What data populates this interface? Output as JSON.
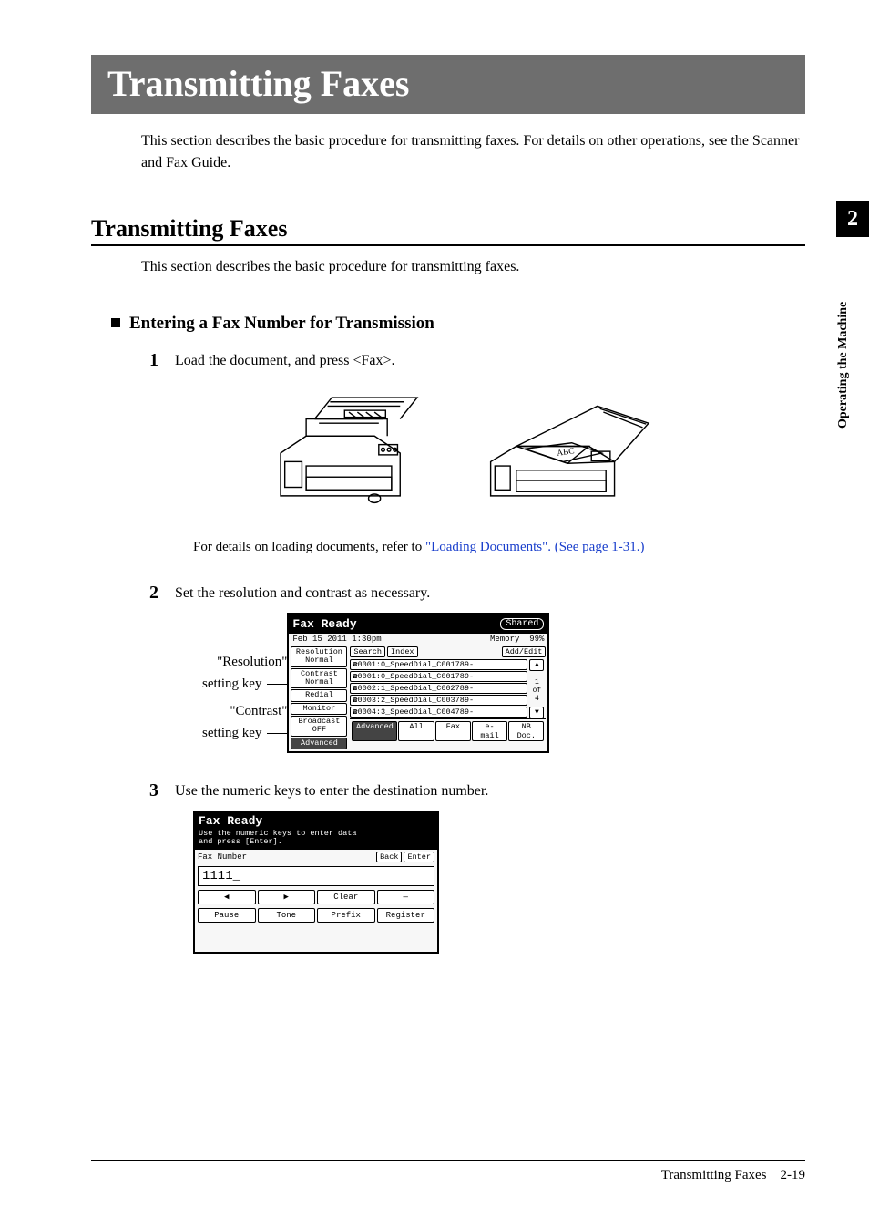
{
  "chapterTitle": "Transmitting Faxes",
  "intro": "This section describes the basic procedure for transmitting faxes. For details on other operations, see the Scanner and Fax Guide.",
  "sectionTitle": "Transmitting Faxes",
  "sectionIntro": "This section describes the basic procedure for transmitting faxes.",
  "subSectionTitle": "Entering a Fax Number for Transmission",
  "steps": {
    "s1num": "1",
    "s1text": "Load the document, and press <Fax>.",
    "s2num": "2",
    "s2text": "Set the resolution and contrast as necessary.",
    "s3num": "3",
    "s3text": "Use the numeric keys to enter the destination number."
  },
  "refPlain": "For details on loading documents, refer to ",
  "refLink": "\"Loading Documents\". (See page 1-31.)",
  "callout1a": "\"Resolution\"",
  "callout1b": "setting key",
  "callout2a": "\"Contrast\"",
  "callout2b": "setting key",
  "lcd": {
    "title": "Fax Ready",
    "shared": "Shared",
    "date": "Feb 15 2011  1:30pm",
    "memLabel": "Memory",
    "memVal": "99%",
    "resolution": "Resolution",
    "normal": "Normal",
    "contrast": "Contrast",
    "redial": "Redial",
    "monitor": "Monitor",
    "broadcast": "Broadcast",
    "off": "OFF",
    "advanced": "Advanced",
    "search": "Search",
    "index": "Index",
    "addEdit": "Add/Edit",
    "items": [
      "☎0001:0_SpeedDial_C001789-",
      "☎0001:0_SpeedDial_C001789-",
      "☎0002:1_SpeedDial_C002789-",
      "☎0003:2_SpeedDial_C003789-",
      "☎0004:3_SpeedDial_C004789-"
    ],
    "of": "of",
    "count1": "1",
    "count4": "4",
    "tabAll": "All",
    "tabFax": "Fax",
    "tabEmail": "e-mail",
    "tabNB": "NB Doc."
  },
  "lcd2": {
    "title": "Fax Ready",
    "sub1": "Use the numeric keys to enter data",
    "sub2": "and press [Enter].",
    "faxNumber": "Fax Number",
    "back": "Back",
    "enter": "Enter",
    "number": "1111_",
    "left": "◀",
    "right": "▶",
    "clear": "Clear",
    "dash": "—",
    "pause": "Pause",
    "tone": "Tone",
    "prefix": "Prefix",
    "register": "Register"
  },
  "side": {
    "num": "2",
    "label": "Operating the Machine"
  },
  "footer": {
    "title": "Transmitting Faxes",
    "page": "2-19"
  }
}
